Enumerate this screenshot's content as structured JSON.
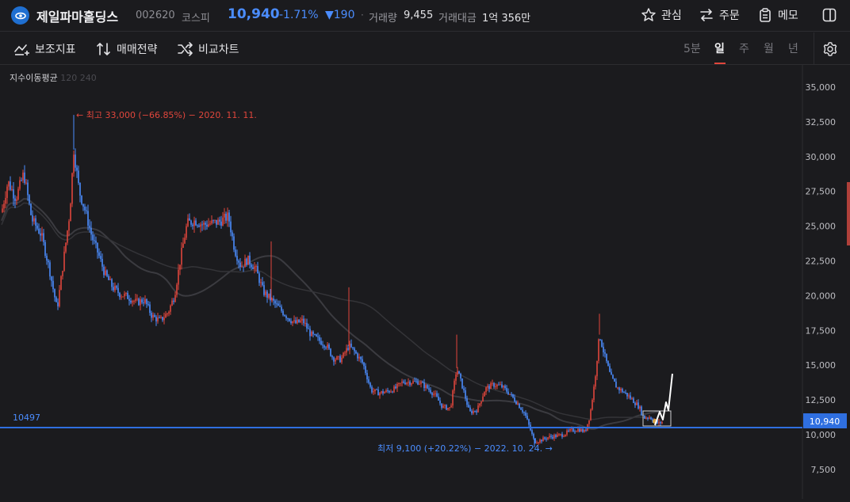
{
  "header": {
    "stock_name": "제일파마홀딩스",
    "code": "002620",
    "market": "코스피",
    "price": "10,940",
    "change_pct": "-1.71%",
    "change_abs": "▼190",
    "dot": "·",
    "volume_label": "거래량",
    "volume": "9,455",
    "amount_label": "거래대금",
    "amount": "1억 356만",
    "favorite_label": "관심",
    "order_label": "주문",
    "memo_label": "메모"
  },
  "toolbar": {
    "indicators_label": "보조지표",
    "strategy_label": "매매전략",
    "compare_label": "비교차트",
    "periods": [
      "5분",
      "일",
      "주",
      "월",
      "년"
    ],
    "active_period": "일"
  },
  "chart_data": {
    "type": "candlestick",
    "ma_label": "지수이동평균",
    "ma_periods": [
      "120",
      "240"
    ],
    "y_ticks": [
      "35,000",
      "32,500",
      "30,000",
      "27,500",
      "25,000",
      "22,500",
      "20,000",
      "17,500",
      "15,000",
      "12,500",
      "10,000",
      "7,500"
    ],
    "ylim": [
      6250,
      36250
    ],
    "current_price": 10940,
    "current_price_label": "10,940",
    "reference_line": 10497,
    "reference_line_label": "10497",
    "high_annotation": "← 최고 33,000 (−66.85%) − 2020. 11. 11.",
    "low_annotation": "최저 9,100 (+20.22%) − 2022. 10. 24. →",
    "high_value": 33000,
    "low_value": 9100,
    "colors": {
      "up": "#e0463c",
      "down": "#4b8dff",
      "line": "#2f6fe0",
      "price_tag": "#2f6fe0"
    }
  }
}
